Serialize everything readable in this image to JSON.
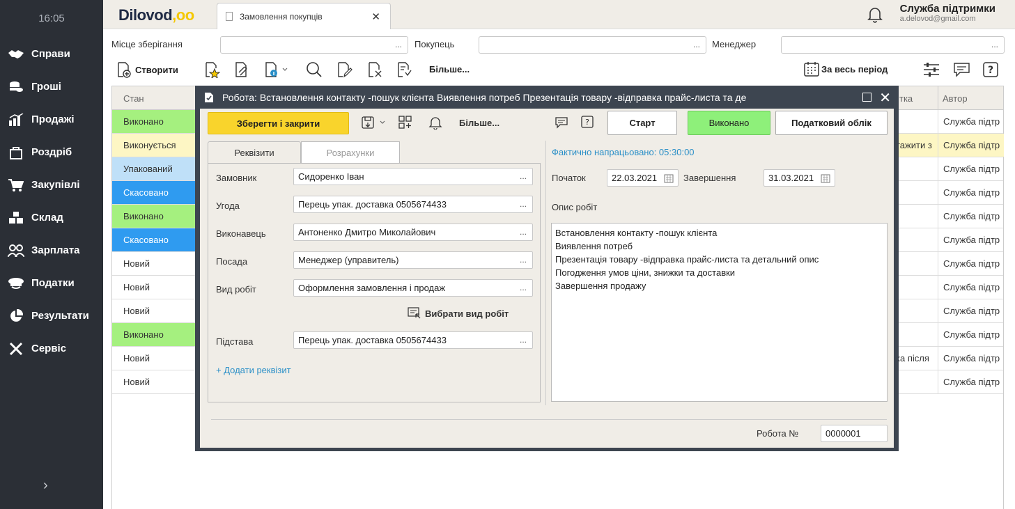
{
  "sidebar": {
    "time": "16:05",
    "items": [
      {
        "label": "Справи",
        "icon": "handshake-icon"
      },
      {
        "label": "Гроші",
        "icon": "coins-icon"
      },
      {
        "label": "Продажі",
        "icon": "chart-icon"
      },
      {
        "label": "Роздріб",
        "icon": "shopping-bag-icon"
      },
      {
        "label": "Закупівлі",
        "icon": "cart-icon"
      },
      {
        "label": "Склад",
        "icon": "boxes-icon"
      },
      {
        "label": "Зарплата",
        "icon": "people-icon"
      },
      {
        "label": "Податки",
        "icon": "officer-cap-icon"
      },
      {
        "label": "Результати",
        "icon": "pie-chart-icon"
      },
      {
        "label": "Сервіс",
        "icon": "tools-icon"
      }
    ],
    "expand": "›"
  },
  "topbar": {
    "logo_text": "Dilovod",
    "logo_dots": ",oo",
    "tab_label": "Замовлення покупців",
    "tab_close": "✕",
    "user_name": "Служба підтримки",
    "user_email": "a.delovod@gmail.com"
  },
  "filters": {
    "storage_label": "Місце зберігання",
    "buyer_label": "Покупець",
    "manager_label": "Менеджер",
    "dots": "..."
  },
  "toolbar": {
    "create_label": "Створити",
    "more_label": "Більше...",
    "period_label": "За весь період"
  },
  "table": {
    "headers": {
      "state": "Стан",
      "note": "тка",
      "author": "Автор"
    },
    "rows": [
      {
        "state": "Виконано",
        "note": "",
        "author": "Служба підтр"
      },
      {
        "state": "Виконується",
        "note": "тажити з",
        "author": "Служба підтр"
      },
      {
        "state": "Упакований",
        "note": "",
        "author": "Служба підтр"
      },
      {
        "state": "Скасовано",
        "note": "",
        "author": "Служба підтр"
      },
      {
        "state": "Виконано",
        "note": "",
        "author": "Служба підтр"
      },
      {
        "state": "Скасовано",
        "note": "",
        "author": "Служба підтр"
      },
      {
        "state": "Новий",
        "note": "",
        "author": "Служба підтр"
      },
      {
        "state": "Новий",
        "note": "",
        "author": "Служба підтр"
      },
      {
        "state": "Новий",
        "note": "",
        "author": "Служба підтр"
      },
      {
        "state": "Виконано",
        "note": "",
        "author": "Служба підтр"
      },
      {
        "state": "Новий",
        "note": "ка після",
        "author": "Служба підтр"
      },
      {
        "state": "Новий",
        "note": "",
        "author": "Служба підтр"
      }
    ],
    "state_colors": {
      "Виконано": "#a5f07f",
      "Виконується": "#fdf6c4",
      "Упакований": "#bfe0f8",
      "Скасовано": "#2f9bf0",
      "Новий": "#ffffff"
    }
  },
  "modal": {
    "title": "Робота: Встановлення контакту -пошук клієнта Виявлення потреб Презентація товару -відправка прайс-листа та де",
    "save_close": "Зберегти і закрити",
    "more": "Більше...",
    "start": "Старт",
    "done": "Виконано",
    "tax": "Податковий облік",
    "tab_requisites": "Реквізити",
    "tab_calculations": "Розрахунки",
    "fields": {
      "customer_label": "Замовник",
      "customer_value": "Сидоренко Іван",
      "deal_label": "Угода",
      "deal_value": "Перець упак. доставка 0505674433",
      "executor_label": "Виконавець",
      "executor_value": "Антоненко Дмитро Миколайович",
      "position_label": "Посада",
      "position_value": "Менеджер (управитель)",
      "worktype_label": "Вид робіт",
      "worktype_value": "Оформлення замовлення і продаж",
      "choose_worktype": "Вибрати вид робіт",
      "basis_label": "Підстава",
      "basis_value": "Перець упак. доставка 0505674433",
      "add_requisite": "+ Додати реквізит"
    },
    "actual_worked": "Фактично напрацьовано: 05:30:00",
    "start_label": "Початок",
    "start_date": "22.03.2021",
    "end_label": "Завершення",
    "end_date": "31.03.2021",
    "description_label": "Опис робіт",
    "description_lines": [
      "Встановлення контакту -пошук клієнта",
      "Виявлення потреб",
      "Презентація товару -відправка прайс-листа та детальний опис",
      "Погодження умов ціни, знижки та  доставки",
      "Завершення продажу"
    ],
    "work_no_label": "Робота №",
    "work_no_value": "0000001"
  },
  "colors": {
    "sidebar_bg": "#2b2f36",
    "accent_yellow": "#f9d42c",
    "done_green": "#8ef07a",
    "link_blue": "#2a8fc7"
  }
}
